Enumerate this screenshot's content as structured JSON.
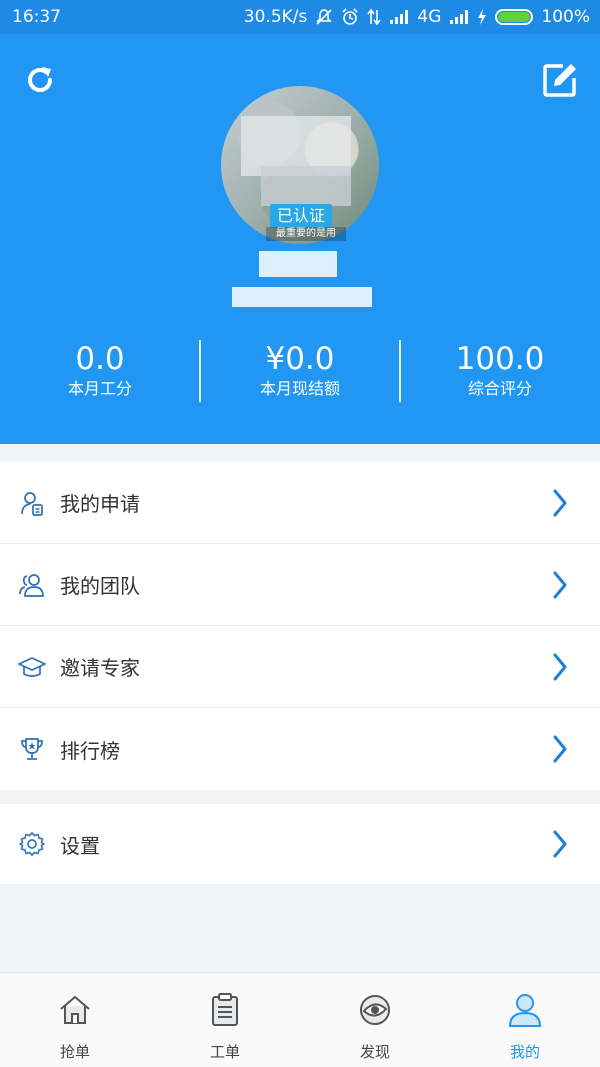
{
  "status_bar": {
    "time": "16:37",
    "net_speed": "30.5K/s",
    "network": "4G",
    "battery": "100%",
    "battery_level": 1.0
  },
  "header": {
    "verified_badge": "已认证",
    "motto": "最重要的是用",
    "stats": [
      {
        "value": "0.0",
        "label": "本月工分"
      },
      {
        "value": "¥0.0",
        "label": "本月现结额"
      },
      {
        "value": "100.0",
        "label": "综合评分"
      }
    ]
  },
  "menu": {
    "items": [
      {
        "label": "我的申请",
        "icon": "application-icon"
      },
      {
        "label": "我的团队",
        "icon": "team-icon"
      },
      {
        "label": "邀请专家",
        "icon": "graduation-cap-icon"
      },
      {
        "label": "排行榜",
        "icon": "trophy-icon"
      }
    ],
    "settings": {
      "label": "设置",
      "icon": "gear-icon"
    }
  },
  "tabbar": {
    "tabs": [
      {
        "label": "抢单",
        "icon": "home-icon"
      },
      {
        "label": "工单",
        "icon": "clipboard-icon"
      },
      {
        "label": "发现",
        "icon": "eye-icon"
      },
      {
        "label": "我的",
        "icon": "user-icon"
      }
    ],
    "active_index": 3
  },
  "colors": {
    "brand_blue": "#2196f3",
    "status_bar": "#1f8ae6",
    "chevron": "#1e7fd6",
    "icon_outline": "#2f6fb4",
    "battery_green": "#5ed13b"
  }
}
